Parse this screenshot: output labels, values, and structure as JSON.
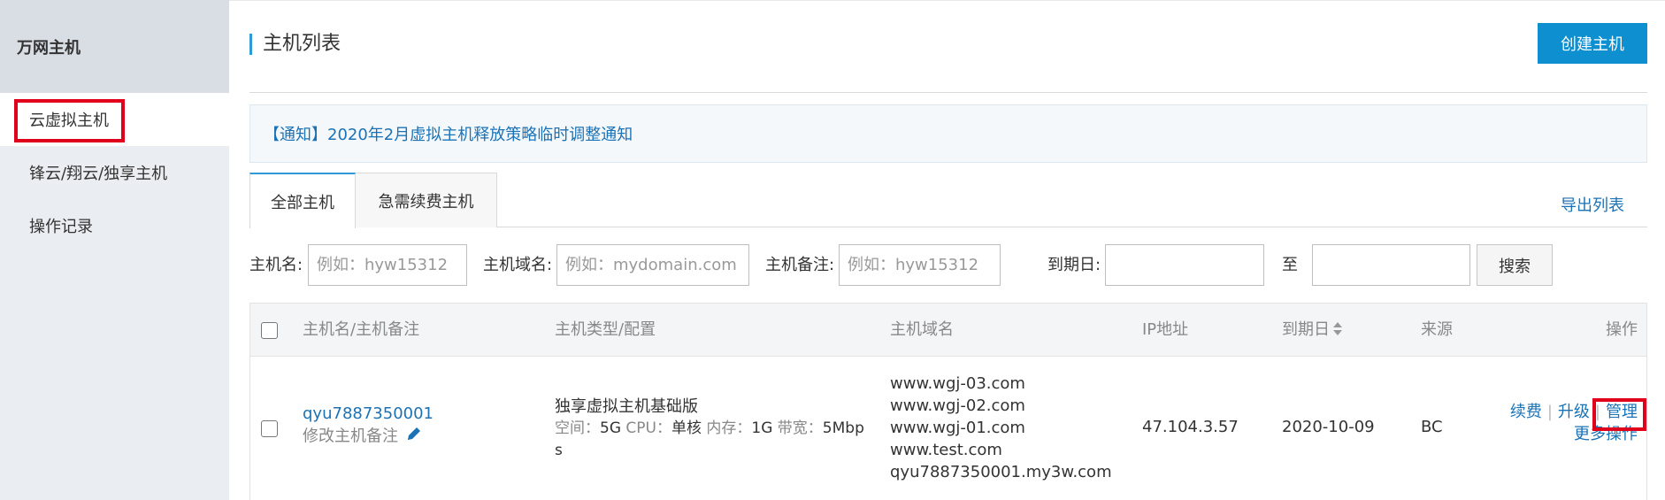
{
  "sidebar": {
    "title": "万网主机",
    "items": [
      {
        "label": "云虚拟主机"
      },
      {
        "label": "锋云/翔云/独享主机"
      },
      {
        "label": "操作记录"
      }
    ]
  },
  "header": {
    "title": "主机列表",
    "create_button": "创建主机"
  },
  "notice": {
    "text": "【通知】2020年2月虚拟主机释放策略临时调整通知"
  },
  "tabs": [
    {
      "label": "全部主机"
    },
    {
      "label": "急需续费主机"
    }
  ],
  "export_label": "导出列表",
  "filters": {
    "host_name_label": "主机名:",
    "host_name_placeholder": "例如：hyw15312",
    "domain_label": "主机域名:",
    "domain_placeholder": "例如：mydomain.com",
    "note_label": "主机备注:",
    "note_placeholder": "例如：hyw15312",
    "expire_label": "到期日:",
    "to_label": "至",
    "search_button": "搜索"
  },
  "table": {
    "headers": {
      "name": "主机名/主机备注",
      "type": "主机类型/配置",
      "domain": "主机域名",
      "ip": "IP地址",
      "expire": "到期日",
      "source": "来源",
      "ops": "操作"
    },
    "rows": [
      {
        "host_name": "qyu7887350001",
        "edit_note": "修改主机备注",
        "type": "独享虚拟主机基础版",
        "space_label": "空间：",
        "space_value": "5G",
        "cpu_label": "CPU：",
        "cpu_value": "单核",
        "mem_label": "内存：",
        "mem_value": "1G",
        "bw_label": "带宽：",
        "bw_value": "5Mbp",
        "bw_tail": "s",
        "domains": [
          "www.wgj-03.com",
          "www.wgj-02.com",
          "www.wgj-01.com",
          "www.test.com",
          "qyu7887350001.my3w.com"
        ],
        "ip": "47.104.3.57",
        "expire": "2020-10-09",
        "source": "BC",
        "op_renew": "续费",
        "op_upgrade": "升级",
        "op_manage": "管理",
        "op_more": "更多操作"
      }
    ]
  },
  "colors": {
    "accent_blue": "#0e8fd0",
    "link_blue": "#1b72b5",
    "highlight_red": "#e0001b"
  }
}
